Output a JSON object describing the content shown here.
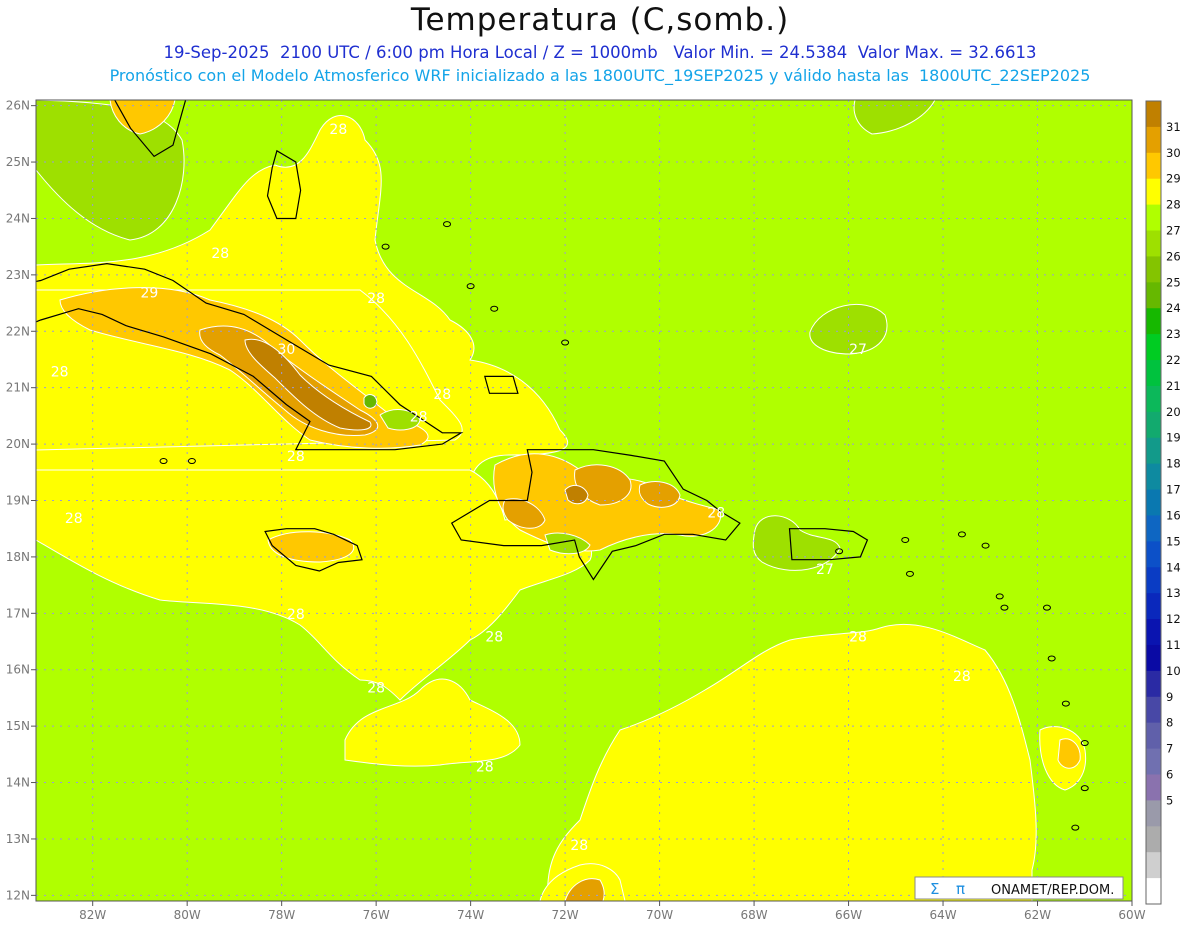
{
  "header": {
    "title": "Temperatura (C,somb.)",
    "subtitle_1": "19-Sep-2025  2100 UTC / 6:00 pm Hora Local / Z = 1000mb   Valor Min. = 24.5384  Valor Max. = 32.6613",
    "subtitle_2": "Pronóstico con el Modelo Atmosferico WRF inicializado a las 1800UTC_19SEP2025 y válido hasta las  1800UTC_22SEP2025"
  },
  "map": {
    "lon_range": [
      -83.2,
      -60
    ],
    "lat_range": [
      11.9,
      26.1
    ],
    "lon_ticks": [
      {
        "v": -82,
        "label": "82W"
      },
      {
        "v": -80,
        "label": "80W"
      },
      {
        "v": -78,
        "label": "78W"
      },
      {
        "v": -76,
        "label": "76W"
      },
      {
        "v": -74,
        "label": "74W"
      },
      {
        "v": -72,
        "label": "72W"
      },
      {
        "v": -70,
        "label": "70W"
      },
      {
        "v": -68,
        "label": "68W"
      },
      {
        "v": -66,
        "label": "66W"
      },
      {
        "v": -64,
        "label": "64W"
      },
      {
        "v": -62,
        "label": "62W"
      },
      {
        "v": -60,
        "label": "60W"
      }
    ],
    "lat_ticks": [
      {
        "v": 26,
        "label": "26N"
      },
      {
        "v": 25,
        "label": "25N"
      },
      {
        "v": 24,
        "label": "24N"
      },
      {
        "v": 23,
        "label": "23N"
      },
      {
        "v": 22,
        "label": "22N"
      },
      {
        "v": 21,
        "label": "21N"
      },
      {
        "v": 20,
        "label": "20N"
      },
      {
        "v": 19,
        "label": "19N"
      },
      {
        "v": 18,
        "label": "18N"
      },
      {
        "v": 17,
        "label": "17N"
      },
      {
        "v": 16,
        "label": "16N"
      },
      {
        "v": 15,
        "label": "15N"
      },
      {
        "v": 14,
        "label": "14N"
      },
      {
        "v": 13,
        "label": "13N"
      },
      {
        "v": 12,
        "label": "12N"
      }
    ],
    "contour_labels": [
      {
        "text": "28",
        "lon": -76.8,
        "lat": 25.5
      },
      {
        "text": "28",
        "lon": -79.3,
        "lat": 23.3
      },
      {
        "text": "29",
        "lon": -80.8,
        "lat": 22.6
      },
      {
        "text": "28",
        "lon": -76.0,
        "lat": 22.5
      },
      {
        "text": "30",
        "lon": -77.9,
        "lat": 21.6
      },
      {
        "text": "28",
        "lon": -82.7,
        "lat": 21.2
      },
      {
        "text": "28",
        "lon": -74.6,
        "lat": 20.8
      },
      {
        "text": "28",
        "lon": -75.1,
        "lat": 20.4
      },
      {
        "text": "28",
        "lon": -77.7,
        "lat": 19.7
      },
      {
        "text": "27",
        "lon": -65.8,
        "lat": 21.6
      },
      {
        "text": "28",
        "lon": -68.8,
        "lat": 18.7
      },
      {
        "text": "27",
        "lon": -66.5,
        "lat": 17.7
      },
      {
        "text": "28",
        "lon": -82.4,
        "lat": 18.6
      },
      {
        "text": "28",
        "lon": -77.7,
        "lat": 16.9
      },
      {
        "text": "28",
        "lon": -73.5,
        "lat": 16.5
      },
      {
        "text": "28",
        "lon": -65.8,
        "lat": 16.5
      },
      {
        "text": "28",
        "lon": -63.6,
        "lat": 15.8
      },
      {
        "text": "28",
        "lon": -76.0,
        "lat": 15.6
      },
      {
        "text": "28",
        "lon": -73.7,
        "lat": 14.2
      },
      {
        "text": "28",
        "lon": -71.7,
        "lat": 12.8
      }
    ],
    "land_outlines": [
      {
        "name": "cuba",
        "coords": [
          [
            -84.9,
            22.9
          ],
          [
            -83.7,
            22.8
          ],
          [
            -83.1,
            22.9
          ],
          [
            -82.5,
            23.1
          ],
          [
            -81.7,
            23.2
          ],
          [
            -80.9,
            23.1
          ],
          [
            -80.3,
            22.9
          ],
          [
            -79.6,
            22.5
          ],
          [
            -78.8,
            22.3
          ],
          [
            -77.8,
            21.8
          ],
          [
            -77.0,
            21.4
          ],
          [
            -76.1,
            21.2
          ],
          [
            -75.5,
            20.7
          ],
          [
            -74.6,
            20.2
          ],
          [
            -74.2,
            20.2
          ],
          [
            -74.6,
            20.0
          ],
          [
            -75.6,
            19.9
          ],
          [
            -76.6,
            19.9
          ],
          [
            -77.7,
            19.9
          ],
          [
            -77.4,
            20.4
          ],
          [
            -77.9,
            20.7
          ],
          [
            -78.6,
            21.2
          ],
          [
            -79.5,
            21.6
          ],
          [
            -80.5,
            21.9
          ],
          [
            -81.3,
            22.1
          ],
          [
            -81.8,
            22.3
          ],
          [
            -82.3,
            22.4
          ],
          [
            -83.1,
            22.2
          ],
          [
            -84.0,
            21.9
          ],
          [
            -84.9,
            21.9
          ]
        ]
      },
      {
        "name": "hispaniola",
        "coords": [
          [
            -74.4,
            18.6
          ],
          [
            -73.6,
            19.0
          ],
          [
            -72.8,
            19.0
          ],
          [
            -72.7,
            19.5
          ],
          [
            -72.8,
            19.9
          ],
          [
            -72.0,
            19.9
          ],
          [
            -71.4,
            19.9
          ],
          [
            -70.6,
            19.8
          ],
          [
            -69.9,
            19.7
          ],
          [
            -69.5,
            19.2
          ],
          [
            -69.0,
            19.0
          ],
          [
            -68.7,
            18.8
          ],
          [
            -68.3,
            18.6
          ],
          [
            -68.6,
            18.3
          ],
          [
            -69.3,
            18.4
          ],
          [
            -69.9,
            18.4
          ],
          [
            -70.5,
            18.2
          ],
          [
            -71.0,
            18.1
          ],
          [
            -71.4,
            17.6
          ],
          [
            -71.7,
            18.0
          ],
          [
            -71.8,
            18.3
          ],
          [
            -72.5,
            18.2
          ],
          [
            -73.3,
            18.2
          ],
          [
            -74.2,
            18.3
          ]
        ]
      },
      {
        "name": "jamaica",
        "coords": [
          [
            -78.35,
            18.45
          ],
          [
            -77.9,
            18.5
          ],
          [
            -77.3,
            18.5
          ],
          [
            -76.9,
            18.4
          ],
          [
            -76.4,
            18.2
          ],
          [
            -76.3,
            17.95
          ],
          [
            -76.8,
            17.9
          ],
          [
            -77.2,
            17.75
          ],
          [
            -77.7,
            17.85
          ],
          [
            -78.2,
            18.2
          ]
        ]
      },
      {
        "name": "puerto-rico",
        "coords": [
          [
            -67.25,
            18.5
          ],
          [
            -66.5,
            18.5
          ],
          [
            -65.9,
            18.45
          ],
          [
            -65.6,
            18.3
          ],
          [
            -65.75,
            18.0
          ],
          [
            -66.4,
            17.95
          ],
          [
            -67.2,
            17.95
          ]
        ]
      },
      {
        "name": "andros",
        "coords": [
          [
            -78.1,
            25.2
          ],
          [
            -77.7,
            25.0
          ],
          [
            -77.6,
            24.5
          ],
          [
            -77.7,
            24.0
          ],
          [
            -78.1,
            24.0
          ],
          [
            -78.3,
            24.4
          ],
          [
            -78.2,
            24.9
          ]
        ]
      },
      {
        "name": "florida",
        "coords": [
          [
            -82.9,
            26.2
          ],
          [
            -81.6,
            26.2
          ],
          [
            -81.2,
            25.6
          ],
          [
            -80.7,
            25.1
          ],
          [
            -80.3,
            25.3
          ],
          [
            -80.1,
            25.9
          ],
          [
            -80.0,
            26.2
          ]
        ]
      },
      {
        "name": "great-inagua",
        "coords": [
          [
            -73.7,
            21.2
          ],
          [
            -73.1,
            21.2
          ],
          [
            -73.0,
            20.9
          ],
          [
            -73.6,
            20.9
          ]
        ]
      }
    ],
    "islands_small": [
      {
        "lon": -64.7,
        "lat": 17.7
      },
      {
        "lon": -64.8,
        "lat": 18.3
      },
      {
        "lon": -63.1,
        "lat": 18.2
      },
      {
        "lon": -62.8,
        "lat": 17.3
      },
      {
        "lon": -62.7,
        "lat": 17.1
      },
      {
        "lon": -61.8,
        "lat": 17.1
      },
      {
        "lon": -61.7,
        "lat": 16.2
      },
      {
        "lon": -61.4,
        "lat": 15.4
      },
      {
        "lon": -61.0,
        "lat": 14.7
      },
      {
        "lon": -61.0,
        "lat": 13.9
      },
      {
        "lon": -61.2,
        "lat": 13.2
      },
      {
        "lon": -61.7,
        "lat": 12.1
      },
      {
        "lon": -66.2,
        "lat": 18.1
      },
      {
        "lon": -63.6,
        "lat": 18.4
      },
      {
        "lon": -75.8,
        "lat": 23.5
      },
      {
        "lon": -74.5,
        "lat": 23.9
      },
      {
        "lon": -73.5,
        "lat": 22.4
      },
      {
        "lon": -72.0,
        "lat": 21.8
      },
      {
        "lon": -80.5,
        "lat": 19.7
      },
      {
        "lon": -79.9,
        "lat": 19.7
      },
      {
        "lon": -74.0,
        "lat": 22.8
      }
    ]
  },
  "legend": {
    "colors": [
      "#c08000",
      "#e4a000",
      "#ffc800",
      "#ffff00",
      "#b0ff00",
      "#9ee000",
      "#84c400",
      "#66b800",
      "#16b800",
      "#00cc22",
      "#00c23e",
      "#0cb85a",
      "#12aa6e",
      "#129a8a",
      "#0e8aa0",
      "#0a78b0",
      "#0e66c2",
      "#0c50c8",
      "#0a3cc4",
      "#0a28bc",
      "#0a14b0",
      "#0a0aa4",
      "#2a2aa4",
      "#4848a6",
      "#6060aa",
      "#7070b0",
      "#8a72ae",
      "#9a9aaa",
      "#acacac",
      "#cfcfcf",
      "#ffffff"
    ],
    "labels": [
      "31",
      "30",
      "29",
      "28",
      "27",
      "26",
      "25",
      "24",
      "23",
      "22",
      "21",
      "20",
      "19",
      "18",
      "17",
      "16",
      "15",
      "14",
      "13",
      "12",
      "11",
      "10",
      "9",
      "8",
      "7",
      "6",
      "5"
    ]
  },
  "credit": {
    "sigma": "Σ",
    "pi": "π",
    "text": "ONAMET/REP.DOM."
  },
  "colors": {
    "shade_27": "#b0ff00",
    "shade_28": "#ffff00",
    "shade_29": "#ffc800",
    "shade_30": "#e4a000",
    "shade_31": "#c08000",
    "shade_26": "#9ee000",
    "shade_25": "#84c400"
  }
}
